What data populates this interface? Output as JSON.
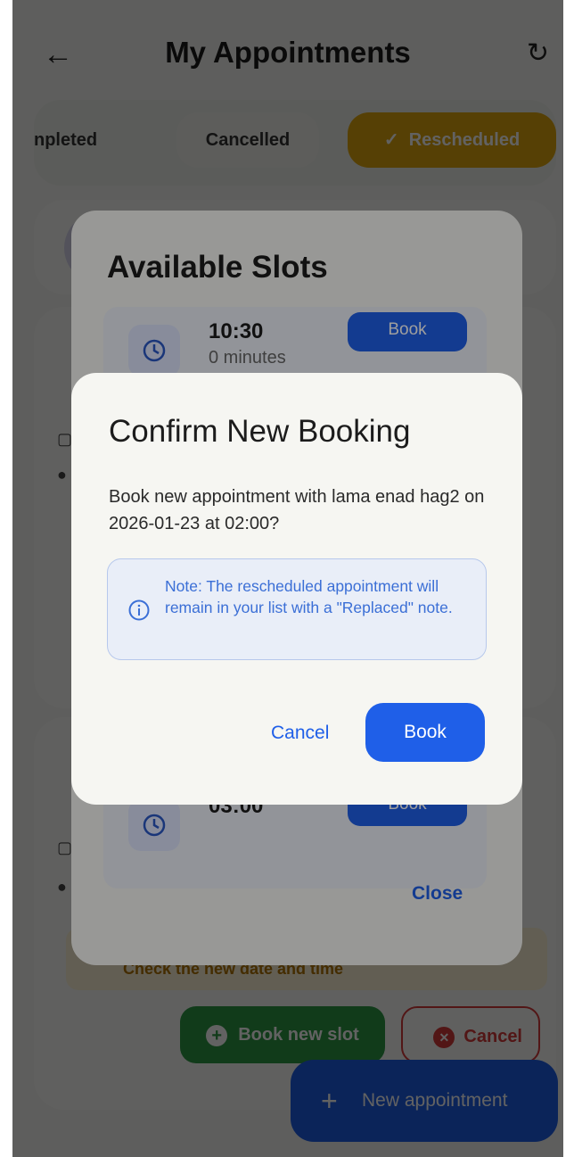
{
  "header": {
    "title": "My Appointments",
    "back_icon": "arrow-left-icon",
    "refresh_icon": "refresh-icon"
  },
  "tabs": [
    {
      "label": "npleted"
    },
    {
      "label": "Cancelled"
    },
    {
      "label": "Rescheduled",
      "selected": true
    }
  ],
  "background": {
    "card_note": "Check the new date and time",
    "book_new_slot": "Book new slot",
    "cancel": "Cancel",
    "fab_label": "New appointment"
  },
  "slots_sheet": {
    "title": "Available Slots",
    "slots": [
      {
        "time": "10:30",
        "duration": "0 minutes",
        "button": "Book"
      },
      {
        "time": "03:00",
        "button": "Book"
      }
    ],
    "close": "Close"
  },
  "dialog": {
    "title": "Confirm New Booking",
    "message": "Book new appointment with lama enad hag2 on 2026-01-23 at 02:00?",
    "note": "Note: The rescheduled appointment will remain in your list with a \"Replaced\" note.",
    "cancel": "Cancel",
    "confirm": "Book"
  },
  "colors": {
    "primary": "#1f5fe8",
    "accent_tab": "#e0a810",
    "success": "#2e9a45",
    "danger": "#d73b3b"
  }
}
